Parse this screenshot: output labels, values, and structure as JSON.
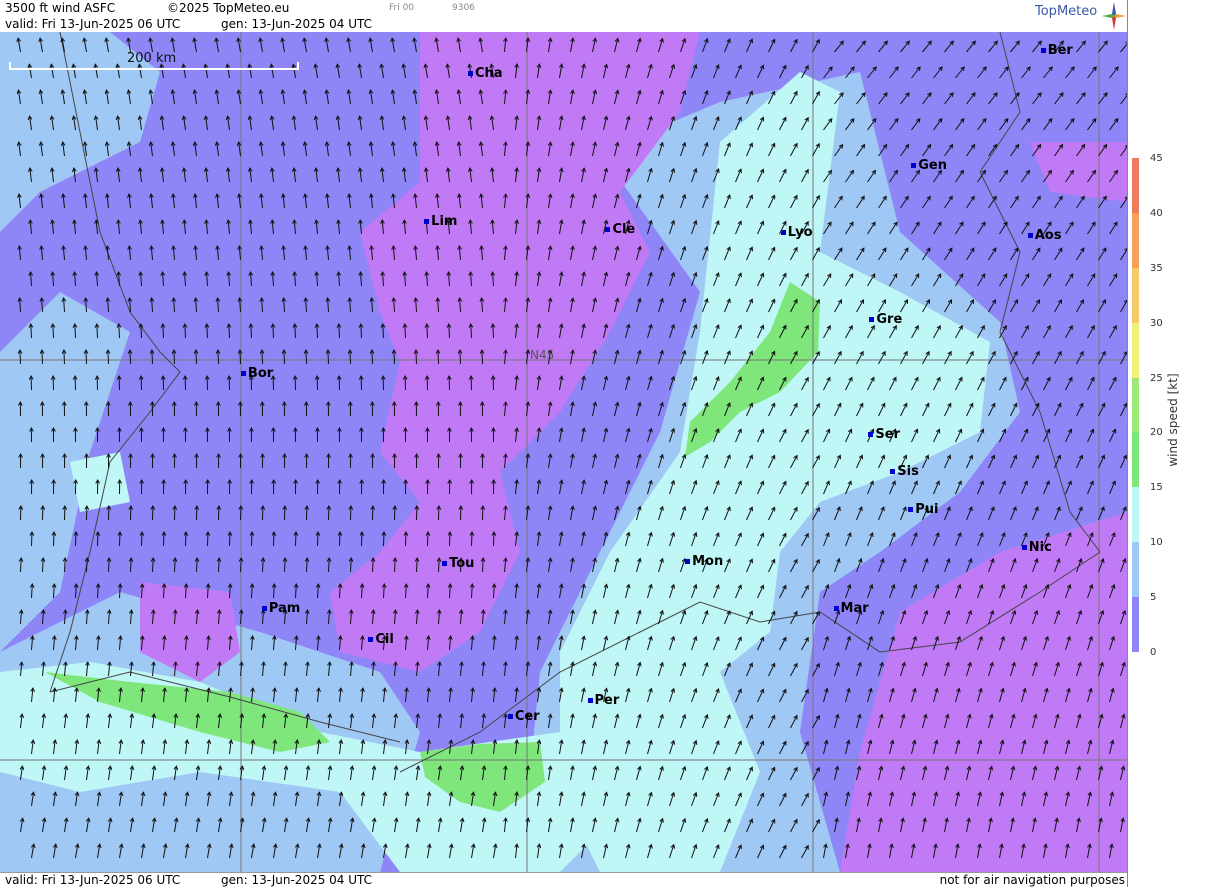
{
  "header": {
    "title": "3500 ft wind ASFC",
    "copyright": "©2025 TopMeteo.eu",
    "run_code": "Fri 00",
    "run_number": "9306",
    "valid": "valid:  Fri  13-Jun-2025  06 UTC",
    "gen": "gen: 13-Jun-2025 04 UTC",
    "logo": "TopMeteo"
  },
  "map": {
    "scale_label": "200 km",
    "lat_label": "N45",
    "cities": [
      {
        "name": "Cha",
        "lat": 46.8,
        "lon": 1.7
      },
      {
        "name": "Ber",
        "lat": 46.95,
        "lon": 7.45
      },
      {
        "name": "Gen",
        "lat": 46.2,
        "lon": 6.15
      },
      {
        "name": "Lim",
        "lat": 45.83,
        "lon": 1.26
      },
      {
        "name": "Cle",
        "lat": 45.78,
        "lon": 3.08
      },
      {
        "name": "Lyo",
        "lat": 45.76,
        "lon": 4.84
      },
      {
        "name": "Aos",
        "lat": 45.74,
        "lon": 7.32
      },
      {
        "name": "Gre",
        "lat": 45.19,
        "lon": 5.73
      },
      {
        "name": "Bor",
        "lat": 44.84,
        "lon": -0.58
      },
      {
        "name": "Ser",
        "lat": 44.44,
        "lon": 5.72
      },
      {
        "name": "Sis",
        "lat": 44.2,
        "lon": 5.94
      },
      {
        "name": "Pui",
        "lat": 43.95,
        "lon": 6.12
      },
      {
        "name": "Nic",
        "lat": 43.7,
        "lon": 7.26
      },
      {
        "name": "Tou",
        "lat": 43.6,
        "lon": 1.44
      },
      {
        "name": "Mon",
        "lat": 43.61,
        "lon": 3.88
      },
      {
        "name": "Mar",
        "lat": 43.3,
        "lon": 5.37
      },
      {
        "name": "Pam",
        "lat": 43.3,
        "lon": -0.37
      },
      {
        "name": "Cil",
        "lat": 43.1,
        "lon": 0.7
      },
      {
        "name": "Per",
        "lat": 42.7,
        "lon": 2.9
      },
      {
        "name": "Cer",
        "lat": 42.6,
        "lon": 2.1
      }
    ]
  },
  "legend": {
    "axis_label": "wind speed [kt]",
    "ticks": [
      "45",
      "40",
      "35",
      "30",
      "25",
      "20",
      "15",
      "10",
      "5",
      "0"
    ],
    "colors": [
      "#f07a5e",
      "#f8a05a",
      "#f5c96e",
      "#f0f07a",
      "#9ee87a",
      "#7ee67a",
      "#bff6f6",
      "#9fc8f5",
      "#8e86f6",
      "#c07af5"
    ]
  },
  "footer": {
    "valid": "valid:  Fri  13-Jun-2025  06 UTC",
    "gen": "gen: 13-Jun-2025 04 UTC",
    "disclaimer": "not for air navigation purposes"
  }
}
